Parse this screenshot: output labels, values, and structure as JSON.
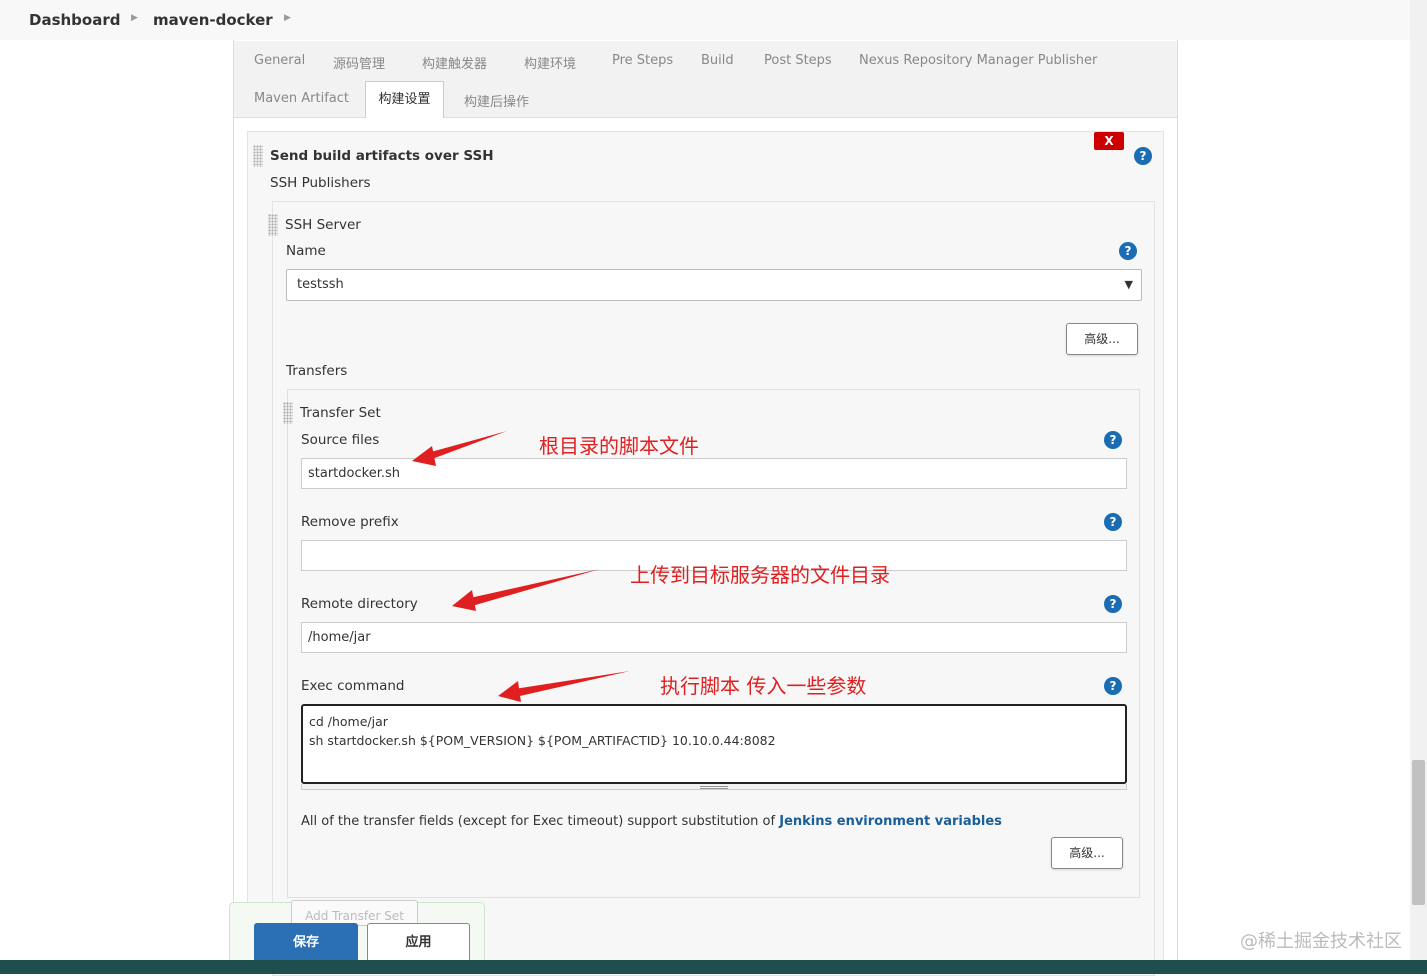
{
  "breadcrumb": {
    "dashboard": "Dashboard",
    "job": "maven-docker"
  },
  "tabs": [
    "General",
    "源码管理",
    "构建触发器",
    "构建环境",
    "Pre Steps",
    "Build",
    "Post Steps",
    "Nexus Repository Manager Publisher",
    "Maven Artifact",
    "构建设置",
    "构建后操作"
  ],
  "active_tab": "构建设置",
  "section": {
    "title": "Send build artifacts over SSH",
    "publishers_label": "SSH Publishers",
    "delete_label": "X",
    "help_label": "?"
  },
  "ssh_server": {
    "title": "SSH Server",
    "name_label": "Name",
    "name_value": "testssh",
    "advanced_label": "高级..."
  },
  "transfers": {
    "label": "Transfers",
    "set_title": "Transfer Set",
    "source_files_label": "Source files",
    "source_files_value": "startdocker.sh",
    "remove_prefix_label": "Remove prefix",
    "remove_prefix_value": "",
    "remote_directory_label": "Remote directory",
    "remote_directory_value": "/home/jar",
    "exec_command_label": "Exec command",
    "exec_command_line1": "cd /home/jar",
    "exec_command_line2": "sh startdocker.sh ${POM_VERSION} ${POM_ARTIFACTID} 10.10.0.44:8082",
    "note_prefix": "All of the transfer fields (except for Exec timeout) support substitution of ",
    "note_link": "Jenkins environment variables",
    "advanced_label": "高级...",
    "add_label": "Add Transfer Set"
  },
  "annotations": {
    "source": "根目录的脚本文件",
    "remote": "上传到目标服务器的文件目录",
    "exec": "执行脚本 传入一些参数"
  },
  "buttons": {
    "save": "保存",
    "apply": "应用"
  },
  "watermark": "@稀土掘金技术社区",
  "colors": {
    "annotation": "#e02020",
    "save": "#2b6fb4",
    "help": "#1a6cb3",
    "delete": "#cc0000",
    "link": "#1a5e9a"
  }
}
